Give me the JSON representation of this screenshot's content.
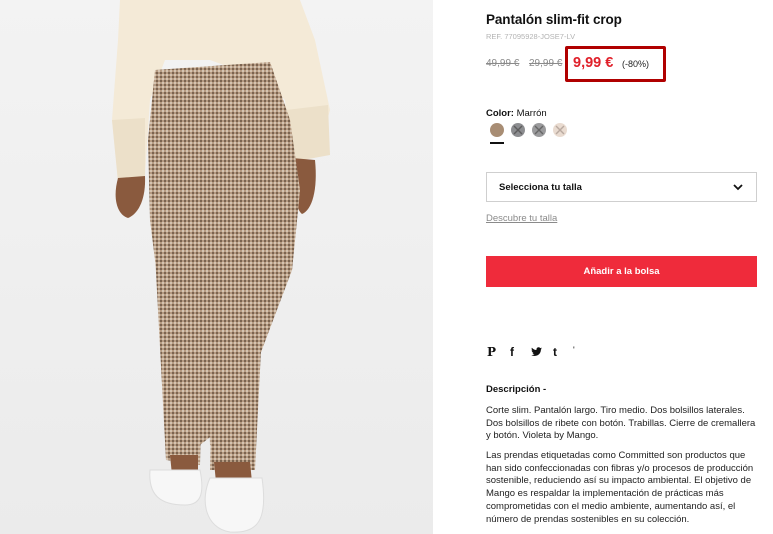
{
  "product": {
    "title": "Pantalón slim-fit crop",
    "ref": "REF. 77095928-JOSE7-LV",
    "old_price_1": "49,99 €",
    "old_price_2": "29,99 €",
    "price_now": "9,99 €",
    "discount": "(-80%)",
    "accent_color": "#ef2b3b",
    "highlight_box_color": "#b00000"
  },
  "color": {
    "label": "Color:",
    "selected": "Marrón",
    "swatches": [
      {
        "name": "brown",
        "hex": "#a88d74",
        "available": true,
        "selected": true
      },
      {
        "name": "grey-dark",
        "hex": "#8c8d90",
        "available": false
      },
      {
        "name": "grey",
        "hex": "#9a9a9c",
        "available": false
      },
      {
        "name": "beige",
        "hex": "#e9dbd0",
        "available": false
      }
    ]
  },
  "size": {
    "placeholder": "Selecciona tu talla",
    "guide_link": "Descubre tu talla"
  },
  "cart": {
    "add_label": "Añadir a la bolsa"
  },
  "share": {
    "icons": [
      "pinterest-icon",
      "facebook-icon",
      "twitter-icon",
      "tumblr-icon"
    ],
    "extra": "'"
  },
  "description": {
    "title": "Descripción  -",
    "p1": "Corte slim. Pantalón largo. Tiro medio. Dos bolsillos laterales. Dos bolsillos de ribete con botón. Trabillas. Cierre de cremallera y botón. Violeta by Mango.",
    "p2": "Las prendas etiquetadas como Committed son productos que han sido confeccionadas con fibras y/o procesos de producción sostenible, reduciendo así su impacto ambiental. El objetivo de Mango es respaldar la implementación de prácticas más comprometidas con el medio ambiente, aumentando así, el número de prendas sostenibles en su colección."
  }
}
